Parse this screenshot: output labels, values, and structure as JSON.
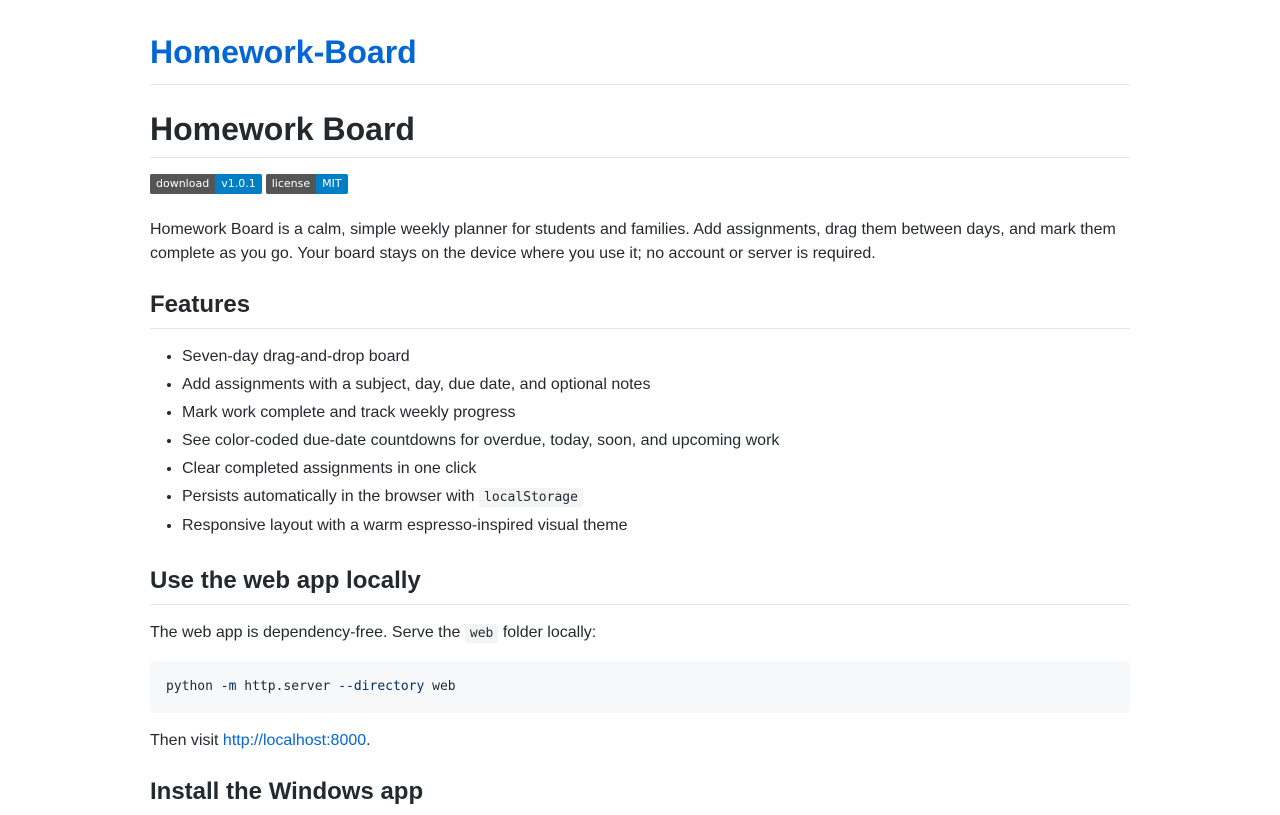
{
  "site": {
    "title": "Homework-Board"
  },
  "doc": {
    "title": "Homework Board",
    "badges": [
      {
        "label": "download",
        "value": "v1.0.1"
      },
      {
        "label": "license",
        "value": "MIT"
      }
    ],
    "intro": "Homework Board is a calm, simple weekly planner for students and families. Add assignments, drag them between days, and mark them complete as you go. Your board stays on the device where you use it; no account or server is required."
  },
  "features": {
    "heading": "Features",
    "items": [
      "Seven-day drag-and-drop board",
      "Add assignments with a subject, day, due date, and optional notes",
      "Mark work complete and track weekly progress",
      "See color-coded due-date countdowns for overdue, today, soon, and upcoming work",
      "Clear completed assignments in one click",
      "Persists automatically in the browser with",
      "Responsive layout with a warm espresso-inspired visual theme"
    ],
    "code_inline": "localStorage"
  },
  "local": {
    "heading": "Use the web app locally",
    "text_before": "The web app is dependency-free. Serve the",
    "code_inline": "web",
    "text_after": "folder locally:",
    "command": {
      "cmd": "python",
      "flag1": "-m",
      "module": "http.server",
      "flag2": "--directory",
      "arg": "web"
    },
    "visit_before": "Then visit",
    "visit_link": "http://localhost:8000",
    "visit_after": "."
  },
  "install": {
    "heading": "Install the Windows app"
  }
}
